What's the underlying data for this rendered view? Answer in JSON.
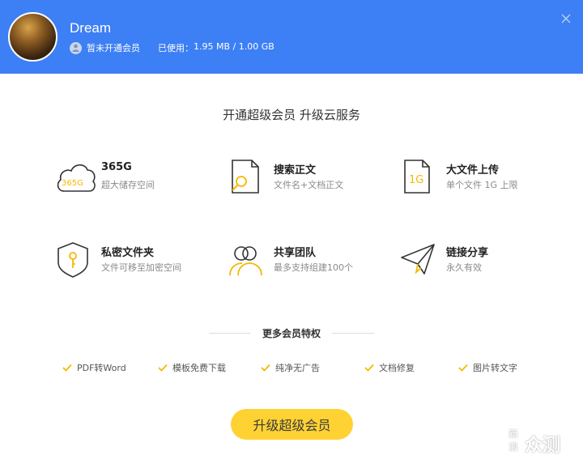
{
  "header": {
    "username": "Dream",
    "membership_status": "暂未开通会员",
    "usage_label": "已使用：",
    "usage_value": "1.95 MB / 1.00 GB",
    "close_icon": "close-icon",
    "bg_color": "#3d7ff5"
  },
  "main": {
    "title": "开通超级会员 升级云服务"
  },
  "features": [
    {
      "icon": "cloud-storage-icon",
      "icon_text": "365G",
      "title": "365G",
      "desc": "超大储存空间"
    },
    {
      "icon": "document-search-icon",
      "title": "搜索正文",
      "desc": "文件名+文档正文"
    },
    {
      "icon": "file-upload-icon",
      "icon_text": "1G",
      "title": "大文件上传",
      "desc": "单个文件 1G 上限"
    },
    {
      "icon": "shield-key-icon",
      "title": "私密文件夹",
      "desc": "文件可移至加密空间"
    },
    {
      "icon": "team-icon",
      "title": "共享团队",
      "desc": "最多支持组建100个"
    },
    {
      "icon": "paper-plane-icon",
      "title": "链接分享",
      "desc": "永久有效"
    }
  ],
  "more_perks": {
    "title": "更多会员特权",
    "items": [
      "PDF转Word",
      "模板免费下载",
      "纯净无广告",
      "文档修复",
      "图片转文字"
    ]
  },
  "upgrade_button": {
    "label": "升级超级会员",
    "color": "#ffd233"
  },
  "watermark": {
    "logo": "新浪",
    "text": "众测"
  },
  "accent_color": "#f5b800"
}
